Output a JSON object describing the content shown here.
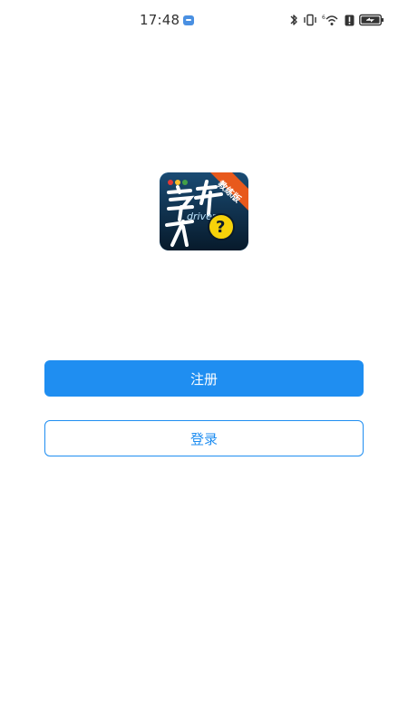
{
  "status_bar": {
    "time": "17:48",
    "icons": [
      "chat-notification-icon",
      "bluetooth-icon",
      "vibrate-icon",
      "wifi-icon",
      "alert-icon",
      "battery-charging-icon"
    ]
  },
  "app": {
    "logo_text": "学车不",
    "logo_sub_text": "driver",
    "logo_ribbon": "教练版"
  },
  "actions": {
    "register_label": "注册",
    "login_label": "登录"
  },
  "colors": {
    "accent": "#1f8ef1",
    "logo_bg": "#0f2e4a",
    "logo_ribbon": "#e8591c",
    "question_yellow": "#f6d20a"
  }
}
